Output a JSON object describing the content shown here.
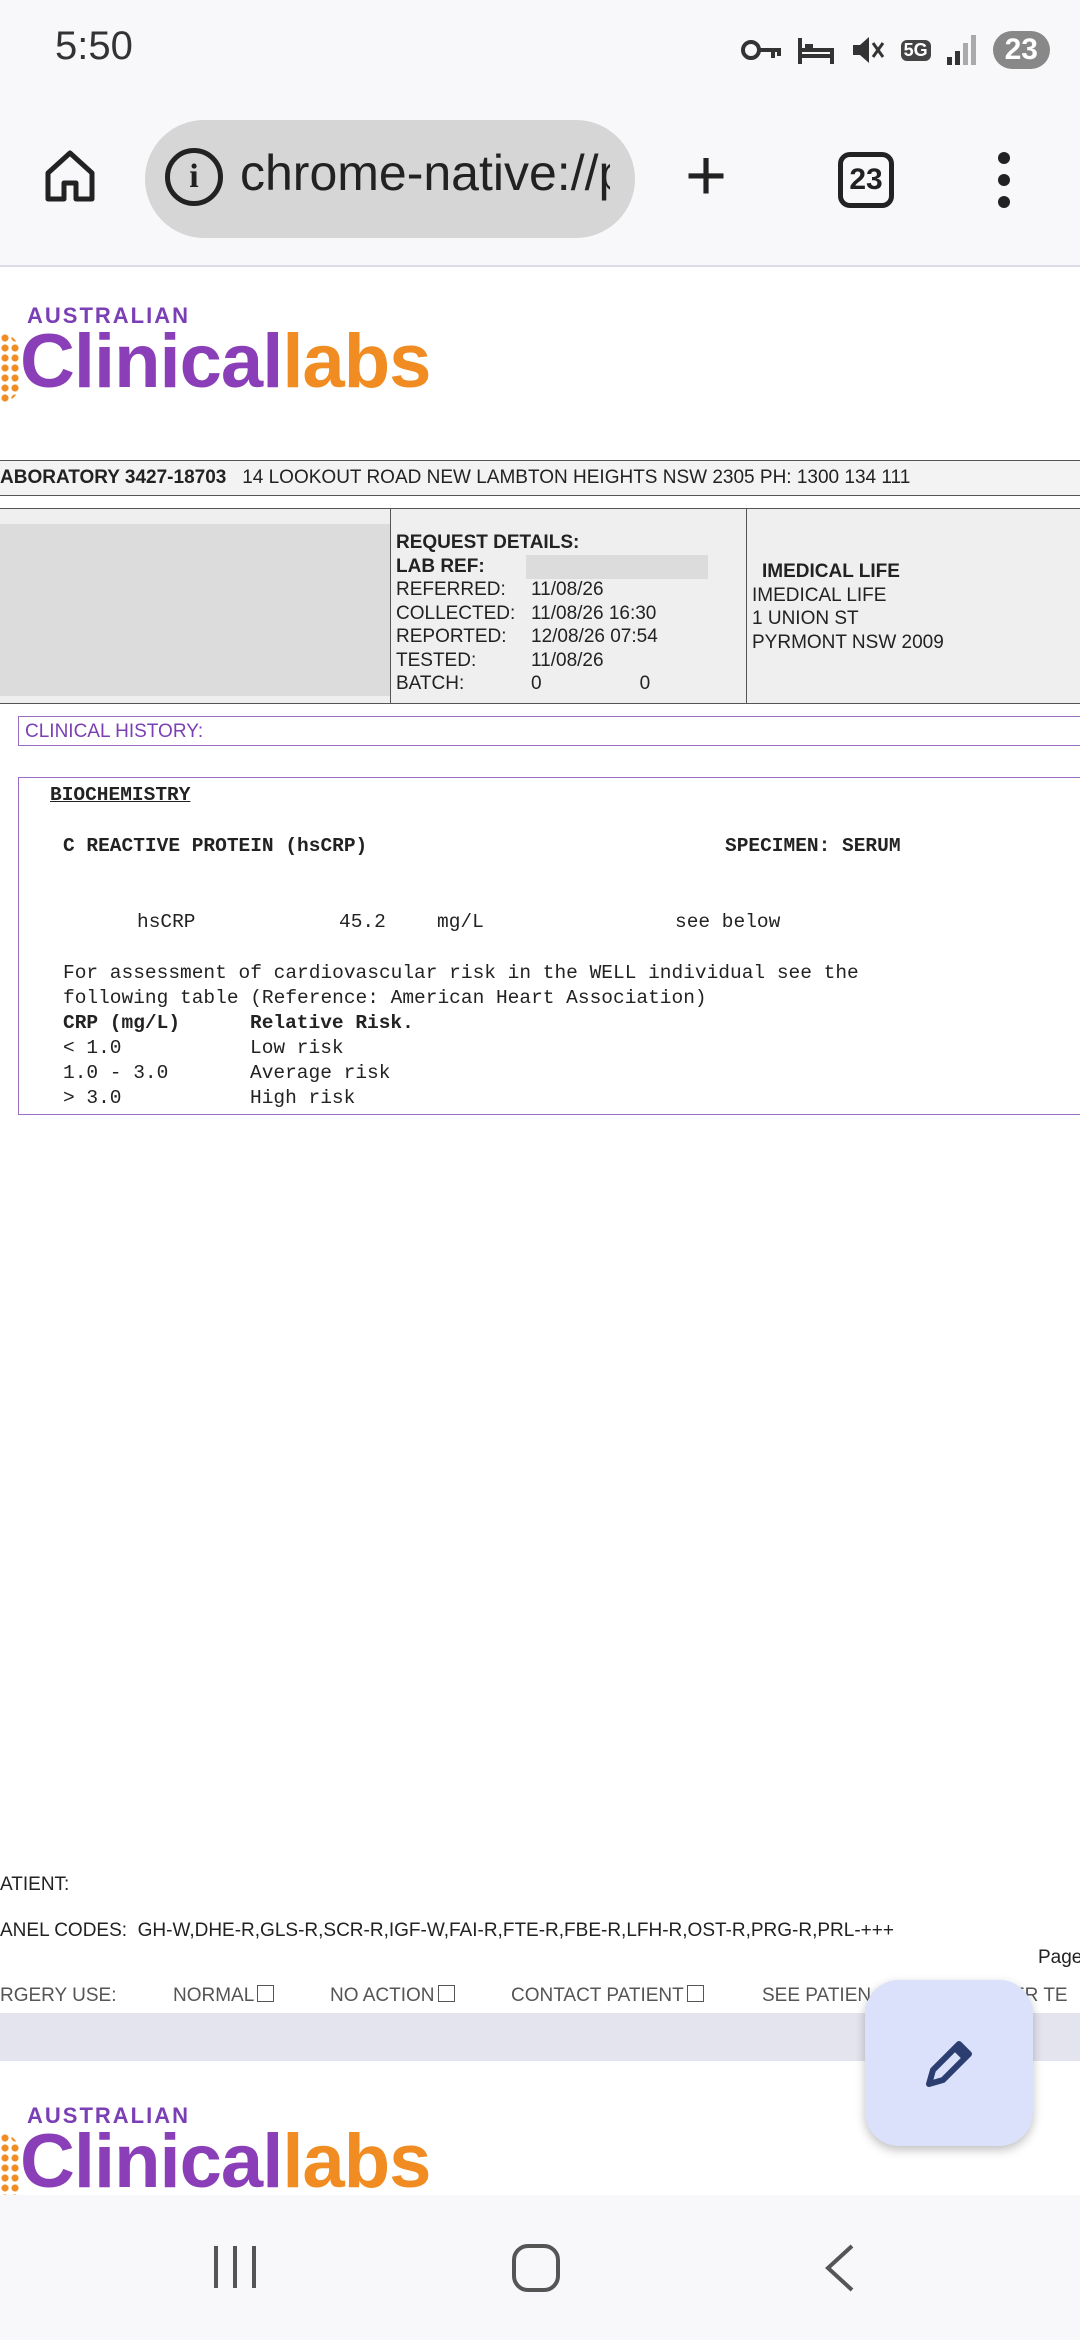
{
  "status_bar": {
    "time": "5:50",
    "battery": "23",
    "network": "5G"
  },
  "browser": {
    "url": "chrome-native://p",
    "tab_count": "23"
  },
  "document": {
    "logo_top": "AUSTRALIAN",
    "logo_clinical": "Clinical",
    "logo_labs": "labs",
    "lab_line_bold": "ABORATORY 3427-18703",
    "lab_line_rest": "14 LOOKOUT ROAD  NEW LAMBTON HEIGHTS  NSW  2305  PH: 1300 134 111",
    "request": {
      "heading": "REQUEST DETAILS:",
      "lab_ref": "LAB REF:",
      "referred_label": "REFERRED:",
      "referred": "11/08/26",
      "collected_label": "COLLECTED:",
      "collected": "11/08/26 16:30",
      "reported_label": "REPORTED:",
      "reported": "12/08/26 07:54",
      "tested_label": "TESTED:",
      "tested": "11/08/26",
      "batch_label": "BATCH:",
      "batch_1": "0",
      "batch_2": "0"
    },
    "doctor": {
      "title": "IMEDICAL LIFE",
      "name": "IMEDICAL LIFE",
      "address1": "1 UNION ST",
      "address2": "PYRMONT NSW 2009"
    },
    "clinical_history": "CLINICAL HISTORY:",
    "section": "BIOCHEMISTRY",
    "test_name": "C REACTIVE PROTEIN (hsCRP)",
    "specimen": "SPECIMEN: SERUM",
    "result": {
      "name": "hsCRP",
      "value": "45.2",
      "unit": "mg/L",
      "note": "see below"
    },
    "assessment_1": "For assessment of cardiovascular risk in the WELL individual see the",
    "assessment_2": "following table (Reference: American Heart Association)",
    "risk_table": {
      "col1": "CRP (mg/L)",
      "col2": "Relative Risk.",
      "rows": [
        {
          "range": "< 1.0",
          "risk": "Low risk"
        },
        {
          "range": "1.0 - 3.0",
          "risk": "Average risk"
        },
        {
          "range": "> 3.0",
          "risk": "High risk"
        }
      ]
    },
    "patient": "ATIENT:",
    "panel_codes_label": "ANEL CODES:",
    "panel_codes": "GH-W,DHE-R,GLS-R,SCR-R,IGF-W,FAI-R,FTE-R,FBE-R,LFH-R,OST-R,PRG-R,PRL-+++",
    "page": "Page",
    "surgery_use": "RGERY USE:",
    "normal": "NORMAL",
    "no_action": "NO ACTION",
    "contact_patient": "CONTACT PATIENT",
    "see_patient": "SEE PATIEN",
    "other": "ER TE"
  }
}
